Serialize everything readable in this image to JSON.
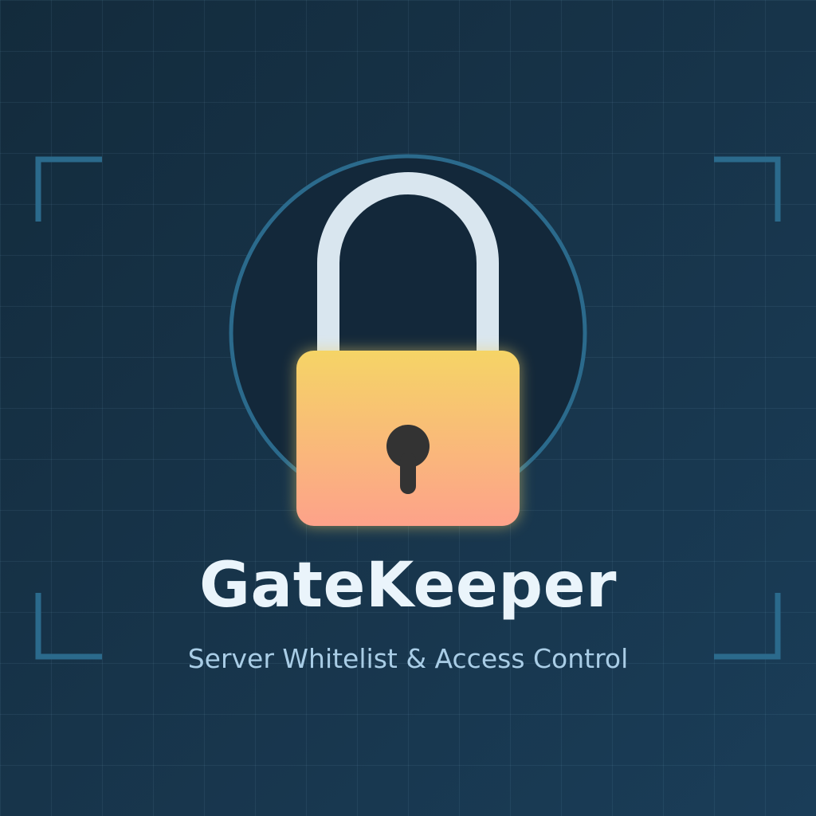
{
  "app": {
    "title": "GateKeeper",
    "tagline": "Server Whitelist & Access Control"
  },
  "icons": {
    "main": "padlock-icon",
    "keyhole": "keyhole-icon",
    "corners": "corner-bracket-icon"
  },
  "colors": {
    "background": "#17344a",
    "frame": "#2b6a8c",
    "shackle": "#d9e6ef",
    "lock_top": "#f5d466",
    "lock_bottom": "#fda28a",
    "keyhole": "#333333",
    "title": "#eaf4fb",
    "tagline": "#a9cde6"
  }
}
